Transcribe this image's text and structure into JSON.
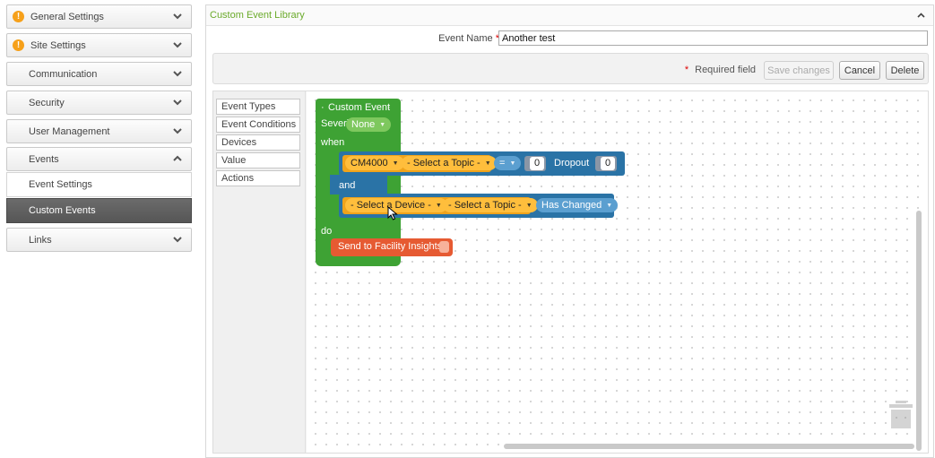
{
  "sidebar": {
    "items": [
      {
        "label": "General Settings",
        "warning": true,
        "expanded": false
      },
      {
        "label": "Site Settings",
        "warning": true,
        "expanded": false
      },
      {
        "label": "Communication",
        "warning": false,
        "expanded": false
      },
      {
        "label": "Security",
        "warning": false,
        "expanded": false
      },
      {
        "label": "User Management",
        "warning": false,
        "expanded": false
      },
      {
        "label": "Events",
        "warning": false,
        "expanded": true
      },
      {
        "label": "Links",
        "warning": false,
        "expanded": false
      }
    ],
    "events_subitems": [
      {
        "label": "Event Settings",
        "active": false
      },
      {
        "label": "Custom Events",
        "active": true
      }
    ],
    "warning_glyph": "!"
  },
  "library": {
    "title": "Custom Event Library",
    "event_name_label": "Event Name",
    "required_star": "*",
    "event_name_value": "Another test",
    "required_field_text": "Required field",
    "buttons": {
      "save": "Save changes",
      "cancel": "Cancel",
      "delete": "Delete"
    }
  },
  "toolbox": {
    "categories": [
      "Event Types",
      "Event Conditions",
      "Devices",
      "Value",
      "Actions"
    ]
  },
  "blocks": {
    "custom_event": {
      "title": "Custom Event",
      "severity_label": "Severity",
      "severity_value": "None",
      "when_label": "when",
      "do_label": "do"
    },
    "condition1": {
      "device": "CM4000",
      "topic": "- Select a Topic -",
      "operator": "=",
      "value1": "0",
      "dropout_label": "Dropout",
      "value2": "0"
    },
    "and_label": "and",
    "condition2": {
      "device": "- Select a Device -",
      "topic": "- Select a Topic -",
      "change": "Has Changed"
    },
    "action": {
      "label": "Send to Facility Insights"
    }
  },
  "colors": {
    "accent_green": "#6aaa2a",
    "event_block": "#3ea234",
    "condition_block": "#2a73a6",
    "device_block": "#f0a31b",
    "action_block": "#e65a32",
    "warning": "#f6a01a",
    "active_nav": "#5e5e5e"
  },
  "icons": {
    "chevron": "chevron-down-icon",
    "chevron_expanded": "chevron-up-icon",
    "warning": "warning-icon",
    "collapse": "collapse-up-icon",
    "trash": "trash-icon",
    "cursor": "mouse-cursor-icon"
  }
}
